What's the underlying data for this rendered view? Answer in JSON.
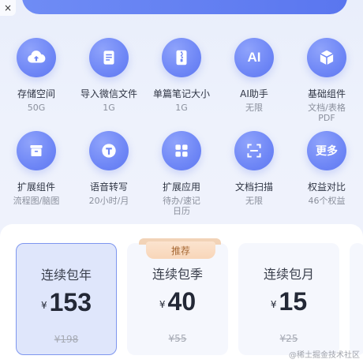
{
  "header": {
    "close_symbol": "×"
  },
  "benefits": [
    {
      "icon": "cloud-upload-icon",
      "title": "存储空间",
      "value": "50G"
    },
    {
      "icon": "document-icon",
      "title": "导入微信文件",
      "value": "1G"
    },
    {
      "icon": "zip-file-icon",
      "title": "单篇笔记大小",
      "value": "1G"
    },
    {
      "icon": "ai-icon",
      "icon_text": "AI",
      "title": "AI助手",
      "value": "无限"
    },
    {
      "icon": "cube-icon",
      "title": "基础组件",
      "value": "文档/表格\nPDF"
    },
    {
      "icon": "box-icon",
      "title": "扩展组件",
      "value": "流程图/脑图"
    },
    {
      "icon": "text-t-icon",
      "title": "语音转写",
      "value": "20小时/月"
    },
    {
      "icon": "apps-grid-icon",
      "title": "扩展应用",
      "value": "待办/速记\n日历"
    },
    {
      "icon": "scan-icon",
      "title": "文档扫描",
      "value": "无限"
    },
    {
      "icon": "more-icon",
      "icon_text": "更多",
      "title": "权益对比",
      "value": "46个权益"
    }
  ],
  "plans": {
    "badge": "推荐",
    "items": [
      {
        "name": "连续包年",
        "currency": "¥",
        "price": "153",
        "original": "¥198",
        "selected": true
      },
      {
        "name": "连续包季",
        "currency": "¥",
        "price": "40",
        "original": "¥55",
        "selected": false
      },
      {
        "name": "连续包月",
        "currency": "¥",
        "price": "15",
        "original": "¥25",
        "selected": false
      }
    ]
  },
  "watermark": "@稀土掘金技术社区"
}
